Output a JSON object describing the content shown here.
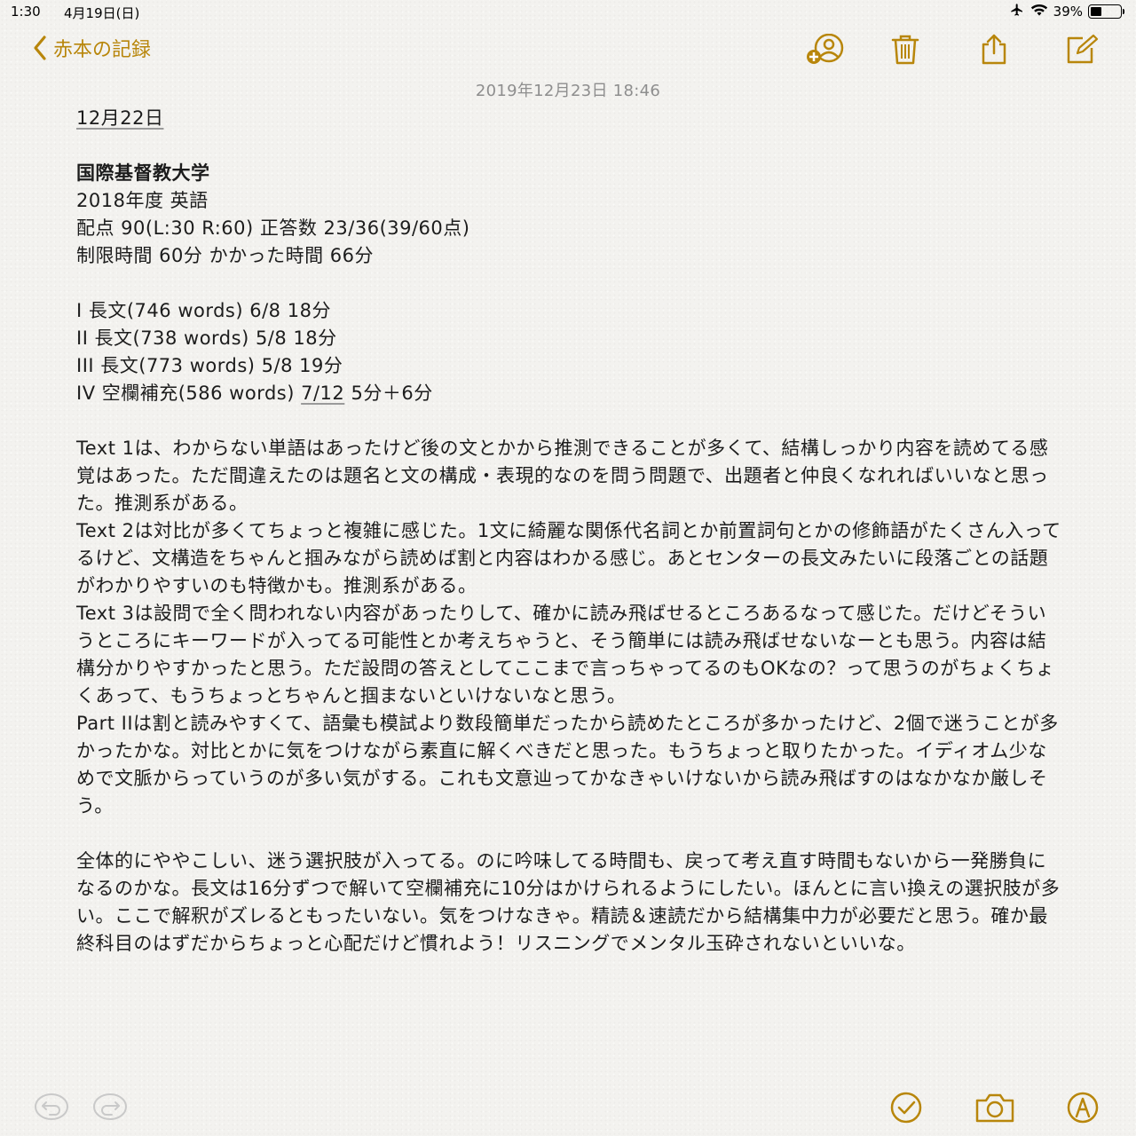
{
  "status_bar": {
    "time": "1:30",
    "date": "4月19日(日)",
    "battery": "39%",
    "battery_level": 0.39,
    "icons": [
      "airplane-icon",
      "wifi-icon",
      "battery-icon"
    ]
  },
  "nav": {
    "back_label": "赤本の記録",
    "icons": [
      "add-person-icon",
      "trash-icon",
      "share-icon",
      "compose-icon"
    ]
  },
  "colors": {
    "accent": "#b8860b",
    "background": "#f3f2ef",
    "text": "#1c1c1c",
    "date_gray": "#8e8e8e"
  },
  "note": {
    "timestamp": "2019年12月23日 18:46",
    "heading": "12月22日",
    "school": "国際基督教大学",
    "year_subject": "2018年度 英語",
    "score": "配点 90(L:30 R:60) 正答数 23/36(39/60点)",
    "time_info": "制限時間 60分 かかった時間 66分",
    "sections": [
      "I 長文(746 words) 6/8 18分",
      "II 長文(738 words) 5/8 18分",
      "III 長文(773 words) 5/8 19分"
    ],
    "section4_prefix": "IV 空欄補充(586 words) ",
    "section4_score": "7/12",
    "section4_suffix": " 5分＋6分",
    "paragraph1": "Text 1は、わからない単語はあったけど後の文とかから推測できることが多くて、結構しっかり内容を読めてる感覚はあった。ただ間違えたのは題名と文の構成・表現的なのを問う問題で、出題者と仲良くなれればいいなと思った。推測系がある。",
    "paragraph2": "Text 2は対比が多くてちょっと複雑に感じた。1文に綺麗な関係代名詞とか前置詞句とかの修飾語がたくさん入ってるけど、文構造をちゃんと掴みながら読めば割と内容はわかる感じ。あとセンターの長文みたいに段落ごとの話題がわかりやすいのも特徴かも。推測系がある。",
    "paragraph3": "Text 3は設問で全く問われない内容があったりして、確かに読み飛ばせるところあるなって感じた。だけどそういうところにキーワードが入ってる可能性とか考えちゃうと、そう簡単には読み飛ばせないなーとも思う。内容は結構分かりやすかったと思う。ただ設問の答えとしてここまで言っちゃってるのもOKなの？って思うのがちょくちょくあって、もうちょっとちゃんと掴まないといけないなと思う。",
    "paragraph4": "Part IIは割と読みやすくて、語彙も模試より数段簡単だったから読めたところが多かったけど、2個で迷うことが多かったかな。対比とかに気をつけながら素直に解くべきだと思った。もうちょっと取りたかった。イディオム少なめで文脈からっていうのが多い気がする。これも文意辿ってかなきゃいけないから読み飛ばすのはなかなか厳しそう。",
    "paragraph5": "全体的にややこしい、迷う選択肢が入ってる。のに吟味してる時間も、戻って考え直す時間もないから一発勝負になるのかな。長文は16分ずつで解いて空欄補充に10分はかけられるようにしたい。ほんとに言い換えの選択肢が多い。ここで解釈がズレるともったいない。気をつけなきゃ。精読＆速読だから結構集中力が必要だと思う。確か最終科目のはずだからちょっと心配だけど慣れよう！リスニングでメンタル玉砕されないといいな。"
  },
  "toolbar": {
    "icons": [
      "undo-icon",
      "redo-icon",
      "checklist-icon",
      "camera-icon",
      "markup-icon"
    ]
  }
}
